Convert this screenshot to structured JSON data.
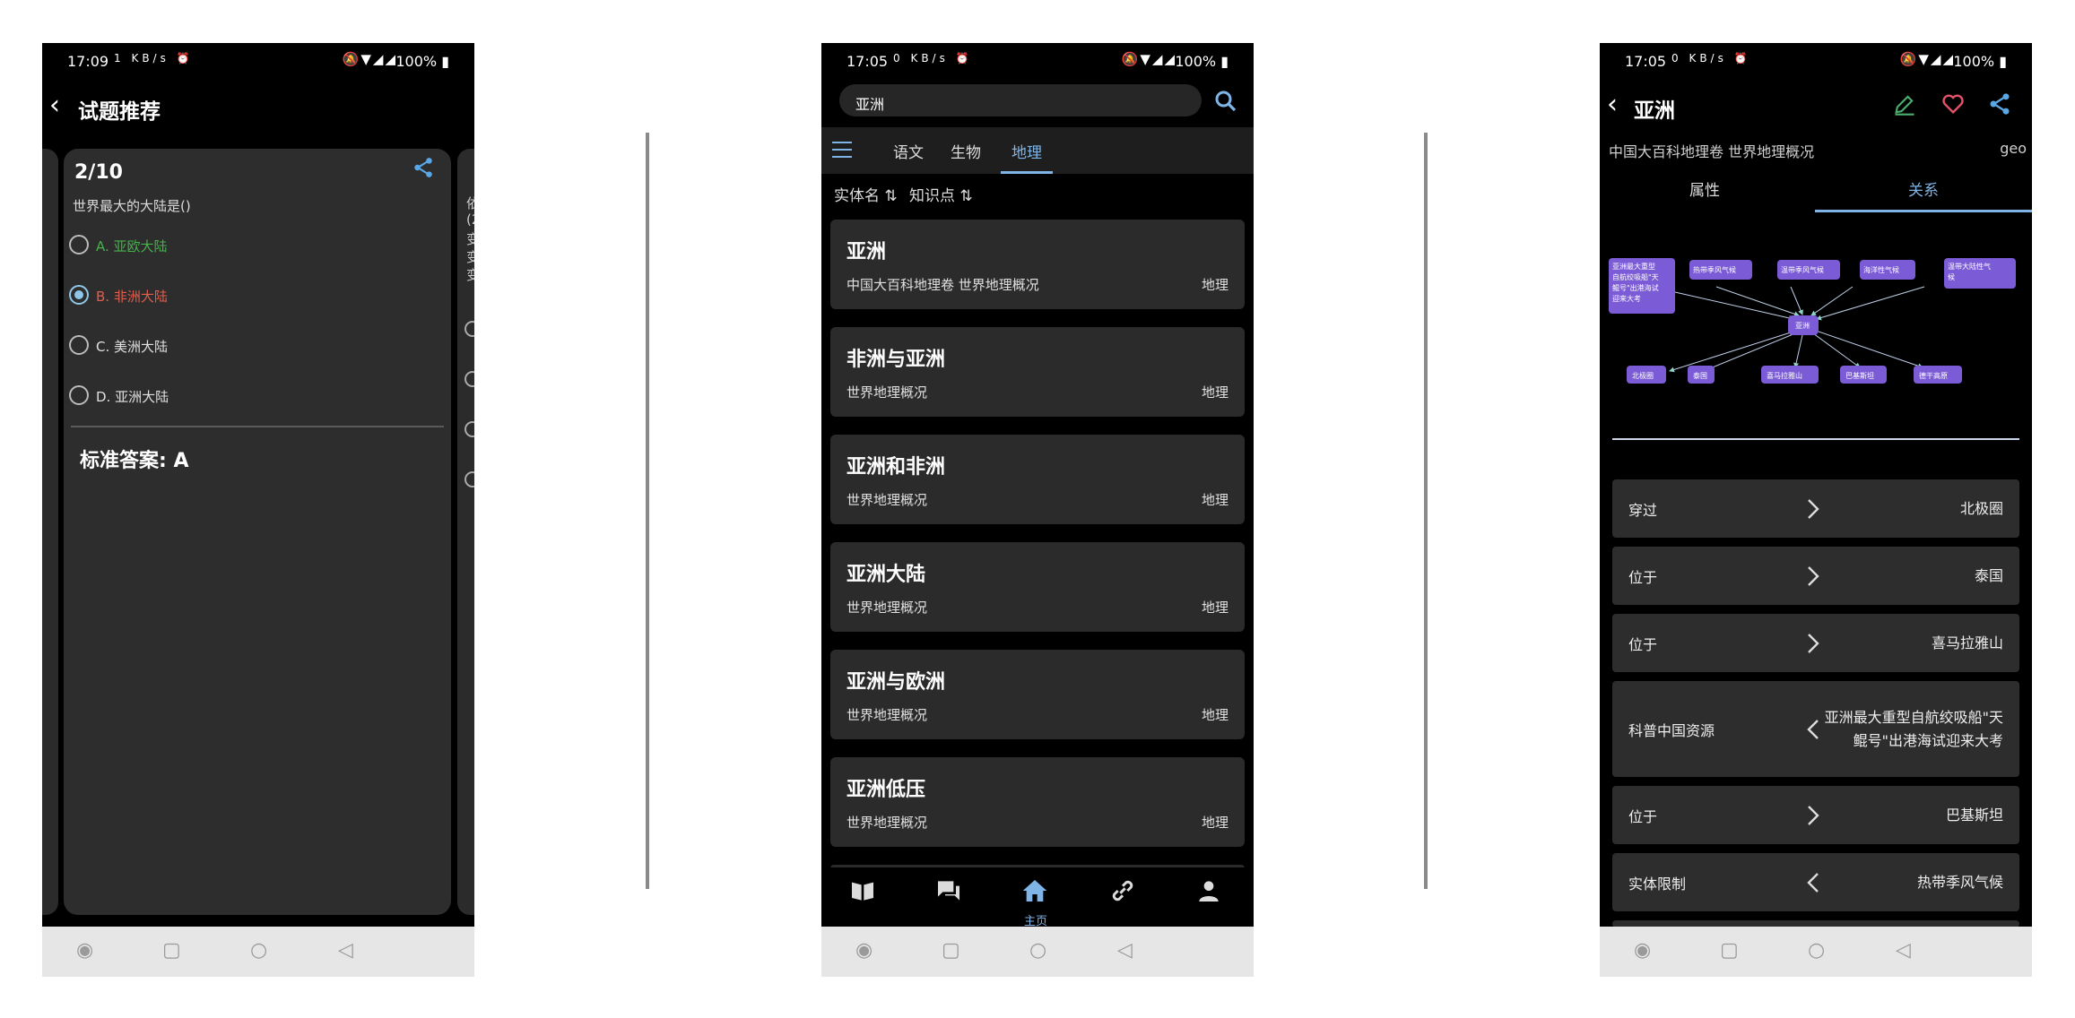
{
  "screen1": {
    "status": {
      "time": "17:09",
      "icons": "1 KB/s ⏰",
      "battery": "100%"
    },
    "title": "试题推荐",
    "card": {
      "counter": "2/10",
      "question": "世界最大的大陆是()",
      "options": [
        "A. 亚欧大陆",
        "B. 非洲大陆",
        "C. 美洲大陆",
        "D. 亚洲大陆"
      ],
      "answer": "标准答案: A"
    },
    "peek_chars": [
      "依",
      "(2",
      "变",
      "变",
      "变"
    ]
  },
  "screen2": {
    "status": {
      "time": "17:05",
      "icons": "0 KB/s ⏰",
      "battery": "100%"
    },
    "search": {
      "value": "亚洲"
    },
    "tabs": [
      "语文",
      "生物",
      "地理"
    ],
    "active_tab": "地理",
    "sort": {
      "entity": "实体名 ⇅",
      "knowledge": "知识点 ⇅"
    },
    "results": [
      {
        "name": "亚洲",
        "source": "中国大百科地理卷 世界地理概况",
        "subject": "地理"
      },
      {
        "name": "非洲与亚洲",
        "source": "世界地理概况",
        "subject": "地理"
      },
      {
        "name": "亚洲和非洲",
        "source": "世界地理概况",
        "subject": "地理"
      },
      {
        "name": "亚洲大陆",
        "source": "世界地理概况",
        "subject": "地理"
      },
      {
        "name": "亚洲与欧洲",
        "source": "世界地理概况",
        "subject": "地理"
      },
      {
        "name": "亚洲低压",
        "source": "世界地理概况",
        "subject": "地理"
      }
    ],
    "bottom_nav": {
      "home_label": "主页"
    },
    "accent": "#7fb5e6"
  },
  "screen3": {
    "status": {
      "time": "17:05",
      "icons": "0 KB/s ⏰",
      "battery": "100%"
    },
    "title": "亚洲",
    "source": "中国大百科地理卷 世界地理概况",
    "subject": "geo",
    "tabs": [
      "属性",
      "关系"
    ],
    "active_tab": "关系",
    "graph": {
      "center": "亚洲",
      "top_nodes": [
        "亚洲最大重型自航绞吸船\"天鲲号\"出港海试迎来大考",
        "热带季风气候",
        "温带季风气候",
        "海洋性气候",
        "温带大陆性气候"
      ],
      "bottom_nodes": [
        "北极圈",
        "泰国",
        "喜马拉雅山",
        "巴基斯坦",
        "德干高原"
      ]
    },
    "relations": [
      {
        "key": "穿过",
        "dir": "out",
        "value": "北极圈"
      },
      {
        "key": "位于",
        "dir": "out",
        "value": "泰国"
      },
      {
        "key": "位于",
        "dir": "out",
        "value": "喜马拉雅山"
      },
      {
        "key": "科普中国资源",
        "dir": "in",
        "value": "亚洲最大重型自航绞吸船\"天鲲号\"出港海试迎来大考"
      },
      {
        "key": "位于",
        "dir": "out",
        "value": "巴基斯坦"
      },
      {
        "key": "实体限制",
        "dir": "in",
        "value": "热带季风气候"
      }
    ],
    "node_color": "#7b5cd6"
  }
}
